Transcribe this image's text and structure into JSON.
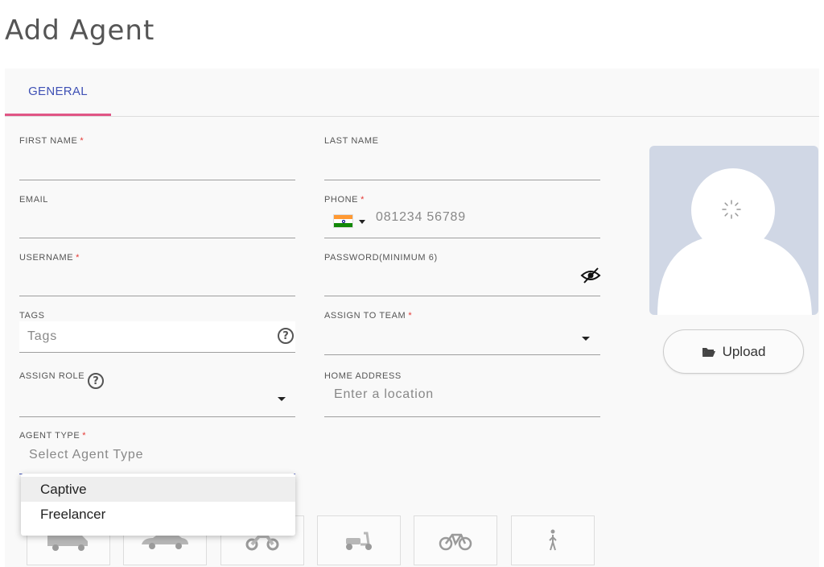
{
  "page": {
    "title": "Add Agent"
  },
  "tabs": [
    {
      "label": "GENERAL",
      "active": true
    }
  ],
  "form": {
    "first_name": {
      "label": "FIRST NAME",
      "required": "*"
    },
    "last_name": {
      "label": "LAST NAME"
    },
    "email": {
      "label": "EMAIL"
    },
    "phone": {
      "label": "PHONE",
      "required": "*",
      "placeholder": "081234 56789",
      "country_flag": "india-flag-icon"
    },
    "username": {
      "label": "USERNAME",
      "required": "*"
    },
    "password": {
      "label": "PASSWORD(MINIMUM 6)",
      "visibility_icon": "eye-off-icon"
    },
    "tags": {
      "label": "TAGS",
      "placeholder": "Tags"
    },
    "assign_to_team": {
      "label": "ASSIGN TO TEAM",
      "required": "*"
    },
    "assign_role": {
      "label": "ASSIGN ROLE"
    },
    "home_address": {
      "label": "HOME ADDRESS",
      "placeholder": "Enter a location"
    },
    "agent_type": {
      "label": "AGENT TYPE",
      "required": "*",
      "placeholder": "Select Agent Type",
      "options": [
        "Captive",
        "Freelancer"
      ]
    }
  },
  "avatar": {
    "icon": "user-silhouette-icon",
    "loading_icon": "spinner-icon"
  },
  "upload": {
    "label": "Upload",
    "icon": "folder-open-icon"
  },
  "vehicles": [
    "truck-icon",
    "car-icon",
    "motorbike-icon",
    "scooter-icon",
    "bicycle-icon",
    "walking-icon"
  ],
  "colors": {
    "accent": "#3f51b5",
    "tab_indicator": "#e05585",
    "required": "#e53935",
    "avatar_bg": "#d0d7e5"
  }
}
